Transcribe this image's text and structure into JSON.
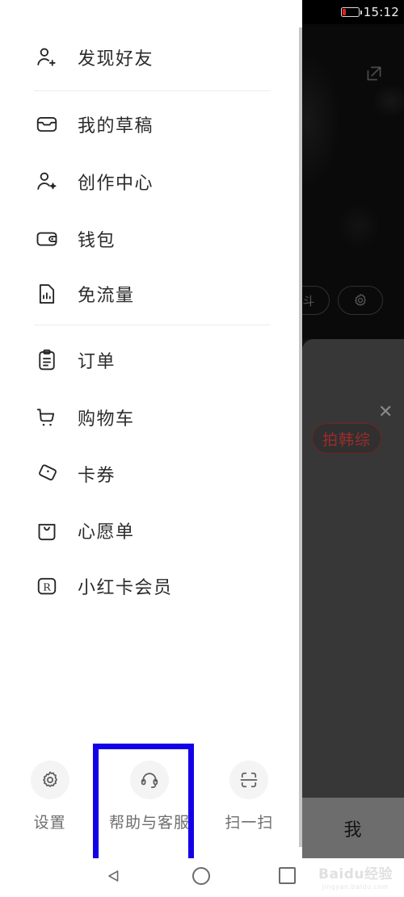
{
  "status_bar": {
    "time": "15:12",
    "battery_icon": "battery-low-icon",
    "battery_color": "#e02020"
  },
  "drawer": {
    "groups": [
      {
        "items": [
          {
            "icon": "person-add-icon",
            "label": "发现好友"
          }
        ]
      },
      {
        "items": [
          {
            "icon": "inbox-icon",
            "label": "我的草稿"
          },
          {
            "icon": "person-star-icon",
            "label": "创作中心"
          },
          {
            "icon": "wallet-icon",
            "label": "钱包"
          },
          {
            "icon": "sim-data-icon",
            "label": "免流量"
          }
        ]
      },
      {
        "items": [
          {
            "icon": "clipboard-icon",
            "label": "订单"
          },
          {
            "icon": "shopping-cart-icon",
            "label": "购物车"
          },
          {
            "icon": "coupon-tag-icon",
            "label": "卡券"
          },
          {
            "icon": "wishlist-bag-icon",
            "label": "心愿单"
          },
          {
            "icon": "r-card-icon",
            "label": "小红卡会员"
          }
        ]
      }
    ],
    "bottom_actions": [
      {
        "icon": "gear-icon",
        "label": "设置",
        "highlighted": false
      },
      {
        "icon": "headset-icon",
        "label": "帮助与客服",
        "highlighted": true
      },
      {
        "icon": "scan-icon",
        "label": "扫一扫",
        "highlighted": false
      }
    ],
    "highlight_color": "#1400e6"
  },
  "background_app": {
    "share_icon": "external-link-icon",
    "gear_icon": "gear-icon",
    "close_icon": "close-icon",
    "pill_tag": "拍韩综",
    "pill_color": "#9c2b2b",
    "tab_label": "我"
  },
  "nav_bar": {
    "back": "back-triangle-icon",
    "home": "home-circle-icon",
    "recents": "recents-square-icon"
  },
  "watermark": {
    "main": "Baidu经验",
    "sub": "jingyan.baidu.com"
  }
}
